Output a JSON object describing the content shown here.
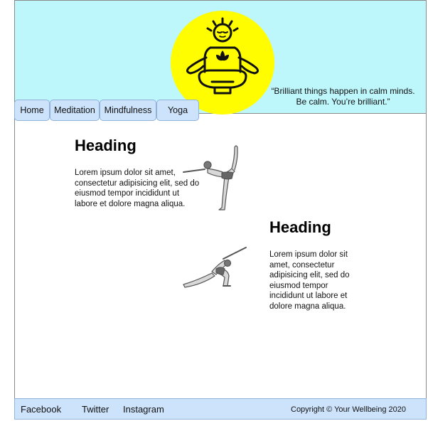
{
  "header": {
    "logo_icon": "meditating-person-icon",
    "quote_line1": "“Brilliant things happen in calm minds.",
    "quote_line2": "Be calm. You’re brilliant.”"
  },
  "nav": {
    "items": [
      {
        "label": "Home"
      },
      {
        "label": "Meditation"
      },
      {
        "label": "Mindfulness"
      },
      {
        "label": "Yoga"
      }
    ]
  },
  "main": {
    "sections": [
      {
        "heading": "Heading",
        "text": "Lorem ipsum dolor sit amet, consectetur adipisicing elit, sed do eiusmod tempor incididunt ut labore et dolore magna aliqua.",
        "image_icon": "dancer-pose-icon"
      },
      {
        "heading": "Heading",
        "text": "Lorem ipsum dolor sit amet, consectetur adipisicing elit, sed do eiusmod tempor incididunt ut labore et dolore magna aliqua.",
        "image_icon": "side-angle-pose-icon"
      }
    ]
  },
  "footer": {
    "links": [
      {
        "label": "Facebook"
      },
      {
        "label": "Twitter"
      },
      {
        "label": "Instagram"
      }
    ],
    "copyright": "Copyright © Your Wellbeing 2020"
  },
  "colors": {
    "header_bg": "#bdf6fb",
    "logo_bg": "#fffd00",
    "nav_bg": "#cde3fb",
    "footer_bg": "#cde3fb"
  }
}
